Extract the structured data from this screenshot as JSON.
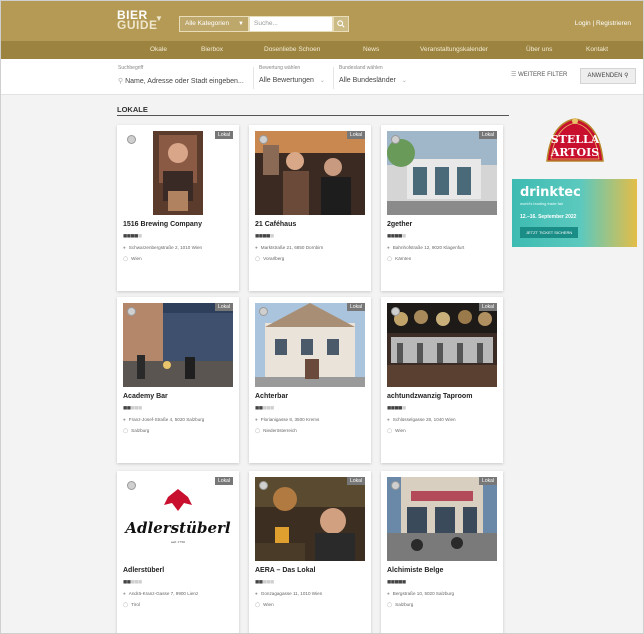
{
  "header": {
    "logo_line1": "BIER",
    "logo_line2": "GUIDE",
    "category_select": "Alle Kategorien",
    "search_placeholder": "Suche...",
    "login": "Login | Registrieren"
  },
  "nav": [
    "Okale",
    "Bierbox",
    "Dosenliebe Schoen",
    "News",
    "Veranstaltungskalender",
    "Über uns",
    "Kontakt"
  ],
  "filters": {
    "keyword_label": "Suchbegriff",
    "keyword_placeholder": "Name, Adresse oder Stadt eingeben...",
    "rating_label": "Bewertung wählen",
    "rating_value": "Alle Bewertungen",
    "state_label": "Bundesland wählen",
    "state_value": "Alle Bundesländer",
    "more_filters": "WEITERE FILTER",
    "apply": "ANWENDEN"
  },
  "section_title": "LOKALE",
  "cards": [
    {
      "name": "1516 Brewing Company",
      "rating": 4,
      "badge": "Lokal",
      "address": "Schwarzenbergstraße 2, 1010 Wien",
      "region": "Wien"
    },
    {
      "name": "21 Caféhaus",
      "rating": 4,
      "badge": "Lokal",
      "address": "Marktstraße 21, 6850 Dornbirn",
      "region": "Vorarlberg"
    },
    {
      "name": "2gether",
      "rating": 4,
      "badge": "Lokal",
      "address": "Bahnhofstraße 12, 9020 Klagenfurt",
      "region": "Kärnten"
    },
    {
      "name": "Academy Bar",
      "rating": 2,
      "badge": "Lokal",
      "address": "Franz-Josef-Straße 4, 5020 Salzburg",
      "region": "Salzburg"
    },
    {
      "name": "Achterbar",
      "rating": 2,
      "badge": "Lokal",
      "address": "Florianigasse 8, 3500 Krems",
      "region": "Niederösterreich"
    },
    {
      "name": "achtundzwanzig Taproom",
      "rating": 4,
      "badge": "Lokal",
      "address": "Schlüsselgasse 28, 1040 Wien",
      "region": "Wien"
    },
    {
      "name": "Adlerstüberl",
      "rating": 2,
      "badge": "Lokal",
      "address": "Andrä-Kranz-Gasse 7, 9900 Lienz",
      "region": "Tirol"
    },
    {
      "name": "AERA – Das Lokal",
      "rating": 2,
      "badge": "Lokal",
      "address": "Gonzagagasse 11, 1010 Wien",
      "region": "Wien"
    },
    {
      "name": "Alchimiste Belge",
      "rating": 5,
      "badge": "Lokal",
      "address": "Bergstraße 10, 5020 Salzburg",
      "region": "Salzburg"
    }
  ],
  "ads": {
    "stella_line1": "STELLA",
    "stella_line2": "ARTOIS",
    "drinktec_brand": "drinktec",
    "drinktec_sub": "world's leading trade fair",
    "drinktec_date": "12.–16. September 2022",
    "drinktec_cta": "JETZT TICKET SICHERN"
  },
  "colors": {
    "header_bg": "#b49a55",
    "nav_bg": "#9c8340",
    "page_bg": "#f3f3f3"
  }
}
